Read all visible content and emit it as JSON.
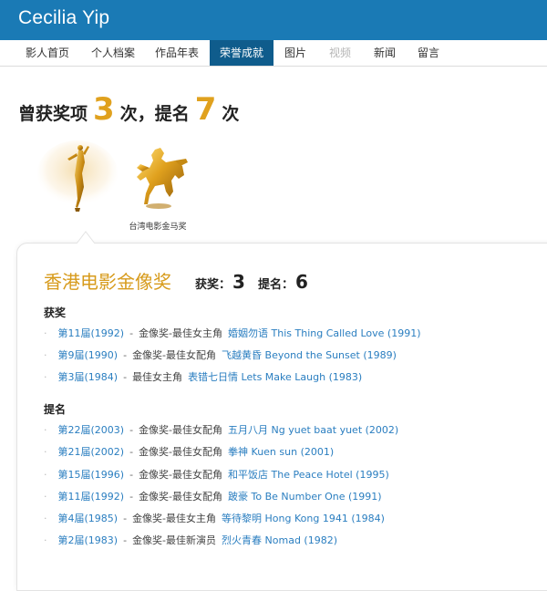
{
  "app": {
    "title": "Cecilia Yip"
  },
  "nav": {
    "items": [
      {
        "label": "影人首页"
      },
      {
        "label": "个人档案"
      },
      {
        "label": "作品年表"
      },
      {
        "label": "荣誉成就"
      },
      {
        "label": "图片"
      },
      {
        "label": "视频"
      },
      {
        "label": "新闻"
      },
      {
        "label": "留言"
      }
    ],
    "active": "荣誉成就",
    "disabled": [
      "视频"
    ]
  },
  "summary": {
    "prefix": "曾获奖项",
    "wins": "3",
    "mid": "次，提名",
    "noms": "7",
    "suffix": "次"
  },
  "awards": [
    {
      "name": "",
      "icon": "hong-kong-film-award-trophy-icon"
    },
    {
      "name": "台湾电影金马奖",
      "icon": "golden-horse-trophy-icon"
    }
  ],
  "section": {
    "title": "香港电影金像奖",
    "wins_label": "获奖：",
    "wins": "3",
    "noms_label": "提名：",
    "noms": "6",
    "won_heading": "获奖",
    "nom_heading": "提名",
    "won": [
      {
        "session": "第11届(1992)",
        "category": "金像奖-最佳女主角",
        "film": "婚姻勿语 This Thing Called Love (1991)"
      },
      {
        "session": "第9届(1990)",
        "category": "金像奖-最佳女配角",
        "film": "飞越黄昏 Beyond the Sunset (1989)"
      },
      {
        "session": "第3届(1984)",
        "category": "最佳女主角",
        "film": "表错七日情 Lets Make Laugh (1983)"
      }
    ],
    "nominated": [
      {
        "session": "第22届(2003)",
        "category": "金像奖-最佳女配角",
        "film": "五月八月 Ng yuet baat yuet (2002)"
      },
      {
        "session": "第21届(2002)",
        "category": "金像奖-最佳女配角",
        "film": "拳神 Kuen sun (2001)"
      },
      {
        "session": "第15届(1996)",
        "category": "金像奖-最佳女配角",
        "film": "和平饭店 The Peace Hotel (1995)"
      },
      {
        "session": "第11届(1992)",
        "category": "金像奖-最佳女配角",
        "film": "跛豪 To Be Number One (1991)"
      },
      {
        "session": "第4届(1985)",
        "category": "金像奖-最佳女主角",
        "film": "等待黎明 Hong Kong 1941 (1984)"
      },
      {
        "session": "第2届(1983)",
        "category": "金像奖-最佳新演员",
        "film": "烈火青春 Nomad (1982)"
      }
    ]
  },
  "colors": {
    "header": "#1a7ab5",
    "nav_active": "#0f5c8c",
    "accent_gold": "#e0a11e",
    "link": "#2a7ec0"
  }
}
